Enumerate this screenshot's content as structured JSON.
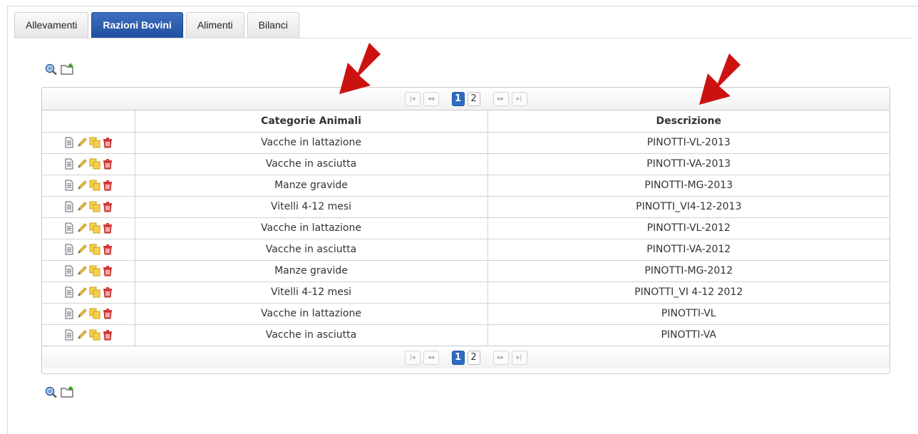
{
  "tabs": [
    {
      "label": "Allevamenti",
      "active": false
    },
    {
      "label": "Razioni Bovini",
      "active": true
    },
    {
      "label": "Alimenti",
      "active": false
    },
    {
      "label": "Bilanci",
      "active": false
    }
  ],
  "toolbar_icons": [
    "search-icon",
    "new-folder-icon"
  ],
  "pager": {
    "pages": [
      "1",
      "2"
    ],
    "current": "1",
    "first": "|◂",
    "prev": "◂◂",
    "next": "▸▸",
    "last": "▸|"
  },
  "table": {
    "columns": [
      "",
      "Categorie Animali",
      "Descrizione"
    ],
    "row_action_icons": [
      "view-document-icon",
      "edit-pencil-icon",
      "copy-icon",
      "delete-trash-icon"
    ],
    "rows": [
      {
        "categoria": "Vacche in lattazione",
        "descrizione": "PINOTTI-VL-2013"
      },
      {
        "categoria": "Vacche in asciutta",
        "descrizione": "PINOTTI-VA-2013"
      },
      {
        "categoria": "Manze gravide",
        "descrizione": "PINOTTI-MG-2013"
      },
      {
        "categoria": "Vitelli 4-12 mesi",
        "descrizione": "PINOTTI_VI4-12-2013"
      },
      {
        "categoria": "Vacche in lattazione",
        "descrizione": "PINOTTI-VL-2012"
      },
      {
        "categoria": "Vacche in asciutta",
        "descrizione": "PINOTTI-VA-2012"
      },
      {
        "categoria": "Manze gravide",
        "descrizione": "PINOTTI-MG-2012"
      },
      {
        "categoria": "Vitelli 4-12 mesi",
        "descrizione": "PINOTTI_VI 4-12 2012"
      },
      {
        "categoria": "Vacche in lattazione",
        "descrizione": "PINOTTI-VL"
      },
      {
        "categoria": "Vacche in asciutta",
        "descrizione": "PINOTTI-VA"
      }
    ]
  },
  "colors": {
    "accent": "#2e6cc4",
    "arrow": "#cc1111"
  }
}
